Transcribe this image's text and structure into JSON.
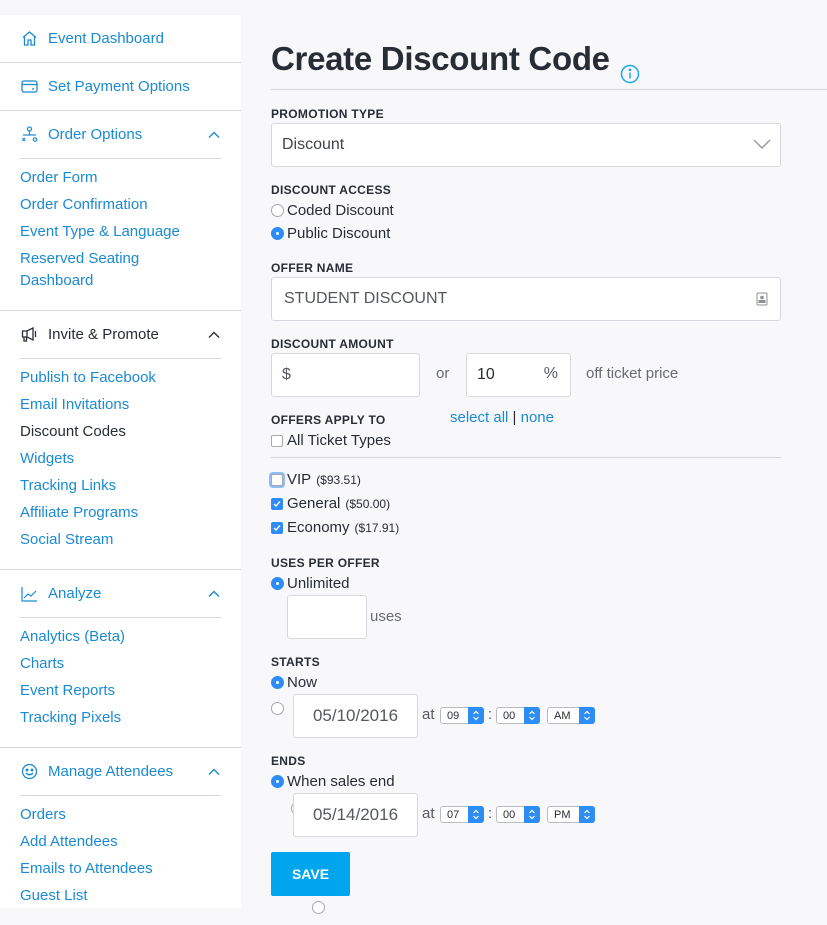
{
  "sidebar": {
    "top_items": [
      {
        "label": "Event Dashboard",
        "icon": "home-icon"
      },
      {
        "label": "Set Payment Options",
        "icon": "credit-card-icon"
      }
    ],
    "sections": [
      {
        "title": "Order Options",
        "icon": "org-chart-icon",
        "color": "blue",
        "links": [
          "Order Form",
          "Order Confirmation",
          "Event Type & Language",
          "Reserved Seating Dashboard"
        ]
      },
      {
        "title": "Invite & Promote",
        "icon": "megaphone-icon",
        "color": "dark",
        "links": [
          "Publish to Facebook",
          "Email Invitations",
          "Discount Codes",
          "Widgets",
          "Tracking Links",
          "Affiliate Programs",
          "Social Stream"
        ],
        "active_link": "Discount Codes"
      },
      {
        "title": "Analyze",
        "icon": "line-chart-icon",
        "color": "blue",
        "links": [
          "Analytics (Beta)",
          "Charts",
          "Event Reports",
          "Tracking Pixels"
        ]
      },
      {
        "title": "Manage Attendees",
        "icon": "smiley-icon",
        "color": "blue",
        "links": [
          "Orders",
          "Add Attendees",
          "Emails to Attendees",
          "Guest List"
        ]
      }
    ]
  },
  "main": {
    "title": "Create Discount Code",
    "promotion_type": {
      "label": "PROMOTION TYPE",
      "value": "Discount"
    },
    "discount_access": {
      "label": "DISCOUNT ACCESS",
      "options": [
        "Coded Discount",
        "Public Discount"
      ],
      "selected": "Public Discount"
    },
    "offer_name": {
      "label": "OFFER NAME",
      "value": "STUDENT DISCOUNT"
    },
    "discount_amount": {
      "label": "DISCOUNT AMOUNT",
      "dollar_prefix": "$",
      "dollar_value": "",
      "or_text": "or",
      "percent_value": "10",
      "percent_suffix": "%",
      "suffix_text": "off ticket price"
    },
    "offers_apply_to": {
      "label": "OFFERS APPLY TO",
      "select_all": "select all",
      "separator": "|",
      "none": "none",
      "all_label": "All Ticket Types",
      "all_checked": false,
      "tickets": [
        {
          "name": "VIP",
          "price": "($93.51)",
          "checked": false
        },
        {
          "name": "General",
          "price": "($50.00)",
          "checked": true
        },
        {
          "name": "Economy",
          "price": "($17.91)",
          "checked": true
        }
      ]
    },
    "uses_per_offer": {
      "label": "USES PER OFFER",
      "unlimited": "Unlimited",
      "uses_value": "",
      "uses_suffix": "uses",
      "selected": "Unlimited"
    },
    "starts": {
      "label": "STARTS",
      "now": "Now",
      "date": "05/10/2016",
      "at": "at",
      "hour": "09",
      "colon": ":",
      "minute": "00",
      "ampm": "AM",
      "selected": "Now"
    },
    "ends": {
      "label": "ENDS",
      "when": "When sales end",
      "date": "05/14/2016",
      "at": "at",
      "hour": "07",
      "colon": ":",
      "minute": "00",
      "ampm": "PM",
      "selected": "When sales end"
    },
    "save_label": "SAVE"
  }
}
